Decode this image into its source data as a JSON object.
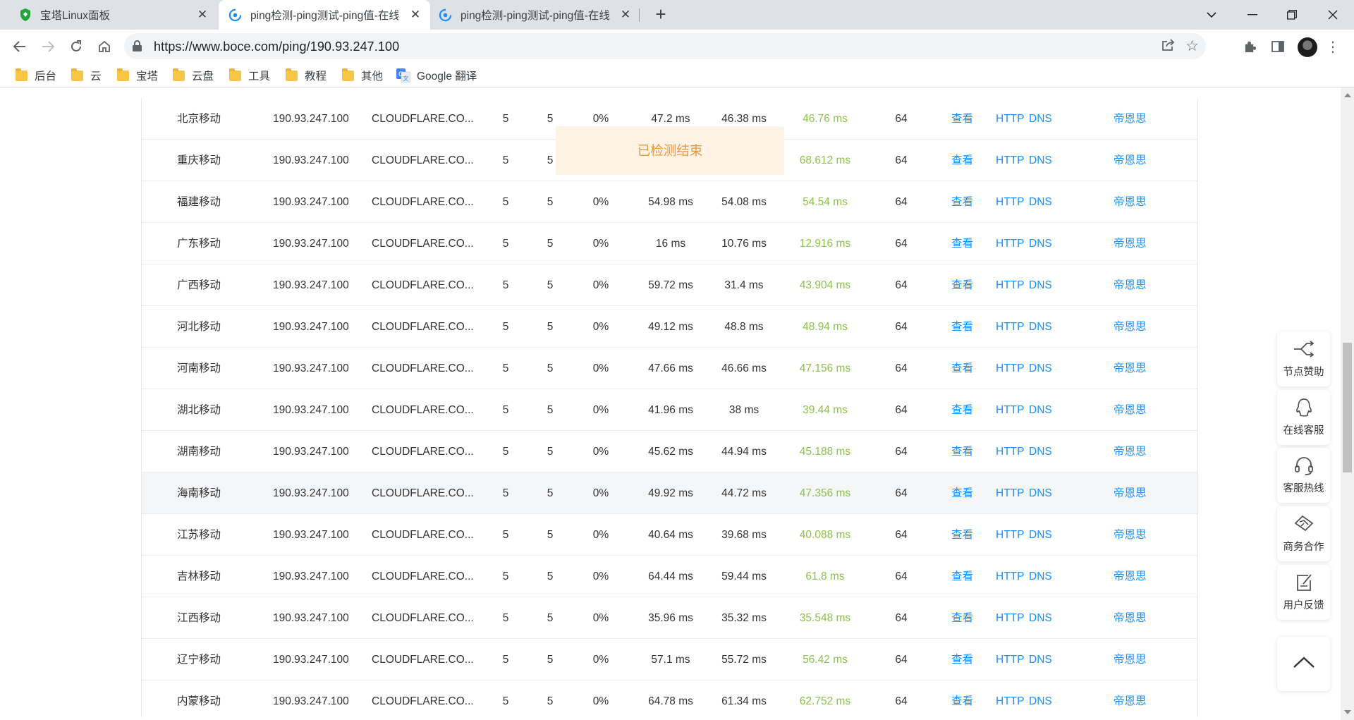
{
  "browser": {
    "tabs": [
      {
        "title": "宝塔Linux面板",
        "icon": "baota-shield-icon"
      },
      {
        "title": "ping检测-ping测试-ping值-在线",
        "icon": "boce-logo-icon",
        "active": true
      },
      {
        "title": "ping检测-ping测试-ping值-在线",
        "icon": "boce-logo-icon"
      }
    ],
    "url": "https://www.boce.com/ping/190.93.247.100",
    "bookmarks": [
      {
        "label": "后台"
      },
      {
        "label": "云"
      },
      {
        "label": "宝塔"
      },
      {
        "label": "云盘"
      },
      {
        "label": "工具"
      },
      {
        "label": "教程"
      },
      {
        "label": "其他"
      },
      {
        "label": "Google 翻译"
      }
    ]
  },
  "status_overlay": "已检测结束",
  "link_labels": {
    "view": "查看",
    "http": "HTTP",
    "dns": "DNS",
    "dc": "帝恩思"
  },
  "rows": [
    {
      "region": "北京移动",
      "ip": "190.93.247.100",
      "isp": "CLOUDFLARE.CO...",
      "sent": "5",
      "recv": "5",
      "loss": "0%",
      "max": "47.2 ms",
      "min": "46.38 ms",
      "avg": "46.76 ms",
      "ttl": "64"
    },
    {
      "region": "重庆移动",
      "ip": "190.93.247.100",
      "isp": "CLOUDFLARE.CO...",
      "sent": "5",
      "recv": "5",
      "loss": "",
      "max": "",
      "min": "",
      "avg": "68.612 ms",
      "ttl": "64"
    },
    {
      "region": "福建移动",
      "ip": "190.93.247.100",
      "isp": "CLOUDFLARE.CO...",
      "sent": "5",
      "recv": "5",
      "loss": "0%",
      "max": "54.98 ms",
      "min": "54.08 ms",
      "avg": "54.54 ms",
      "ttl": "64"
    },
    {
      "region": "广东移动",
      "ip": "190.93.247.100",
      "isp": "CLOUDFLARE.CO...",
      "sent": "5",
      "recv": "5",
      "loss": "0%",
      "max": "16 ms",
      "min": "10.76 ms",
      "avg": "12.916 ms",
      "ttl": "64"
    },
    {
      "region": "广西移动",
      "ip": "190.93.247.100",
      "isp": "CLOUDFLARE.CO...",
      "sent": "5",
      "recv": "5",
      "loss": "0%",
      "max": "59.72 ms",
      "min": "31.4 ms",
      "avg": "43.904 ms",
      "ttl": "64"
    },
    {
      "region": "河北移动",
      "ip": "190.93.247.100",
      "isp": "CLOUDFLARE.CO...",
      "sent": "5",
      "recv": "5",
      "loss": "0%",
      "max": "49.12 ms",
      "min": "48.8 ms",
      "avg": "48.94 ms",
      "ttl": "64"
    },
    {
      "region": "河南移动",
      "ip": "190.93.247.100",
      "isp": "CLOUDFLARE.CO...",
      "sent": "5",
      "recv": "5",
      "loss": "0%",
      "max": "47.66 ms",
      "min": "46.66 ms",
      "avg": "47.156 ms",
      "ttl": "64"
    },
    {
      "region": "湖北移动",
      "ip": "190.93.247.100",
      "isp": "CLOUDFLARE.CO...",
      "sent": "5",
      "recv": "5",
      "loss": "0%",
      "max": "41.96 ms",
      "min": "38 ms",
      "avg": "39.44 ms",
      "ttl": "64"
    },
    {
      "region": "湖南移动",
      "ip": "190.93.247.100",
      "isp": "CLOUDFLARE.CO...",
      "sent": "5",
      "recv": "5",
      "loss": "0%",
      "max": "45.62 ms",
      "min": "44.94 ms",
      "avg": "45.188 ms",
      "ttl": "64"
    },
    {
      "region": "海南移动",
      "ip": "190.93.247.100",
      "isp": "CLOUDFLARE.CO...",
      "sent": "5",
      "recv": "5",
      "loss": "0%",
      "max": "49.92 ms",
      "min": "44.72 ms",
      "avg": "47.356 ms",
      "ttl": "64",
      "highlight": true
    },
    {
      "region": "江苏移动",
      "ip": "190.93.247.100",
      "isp": "CLOUDFLARE.CO...",
      "sent": "5",
      "recv": "5",
      "loss": "0%",
      "max": "40.64 ms",
      "min": "39.68 ms",
      "avg": "40.088 ms",
      "ttl": "64"
    },
    {
      "region": "吉林移动",
      "ip": "190.93.247.100",
      "isp": "CLOUDFLARE.CO...",
      "sent": "5",
      "recv": "5",
      "loss": "0%",
      "max": "64.44 ms",
      "min": "59.44 ms",
      "avg": "61.8 ms",
      "ttl": "64"
    },
    {
      "region": "江西移动",
      "ip": "190.93.247.100",
      "isp": "CLOUDFLARE.CO...",
      "sent": "5",
      "recv": "5",
      "loss": "0%",
      "max": "35.96 ms",
      "min": "35.32 ms",
      "avg": "35.548 ms",
      "ttl": "64"
    },
    {
      "region": "辽宁移动",
      "ip": "190.93.247.100",
      "isp": "CLOUDFLARE.CO...",
      "sent": "5",
      "recv": "5",
      "loss": "0%",
      "max": "57.1 ms",
      "min": "55.72 ms",
      "avg": "56.42 ms",
      "ttl": "64"
    },
    {
      "region": "内蒙移动",
      "ip": "190.93.247.100",
      "isp": "CLOUDFLARE.CO...",
      "sent": "5",
      "recv": "5",
      "loss": "0%",
      "max": "64.78 ms",
      "min": "61.34 ms",
      "avg": "62.752 ms",
      "ttl": "64"
    }
  ],
  "side_tools": [
    {
      "label": "节点赞助",
      "icon": "node-share-icon"
    },
    {
      "label": "在线客服",
      "icon": "qq-chat-icon"
    },
    {
      "label": "客服热线",
      "icon": "headset-icon"
    },
    {
      "label": "商务合作",
      "icon": "handshake-icon"
    },
    {
      "label": "用户反馈",
      "icon": "feedback-edit-icon"
    }
  ],
  "colors": {
    "link": "#1890ff",
    "avg_latency": "#8bc34a",
    "overlay_bg": "#fff3e6",
    "overlay_text": "#e8983e"
  }
}
